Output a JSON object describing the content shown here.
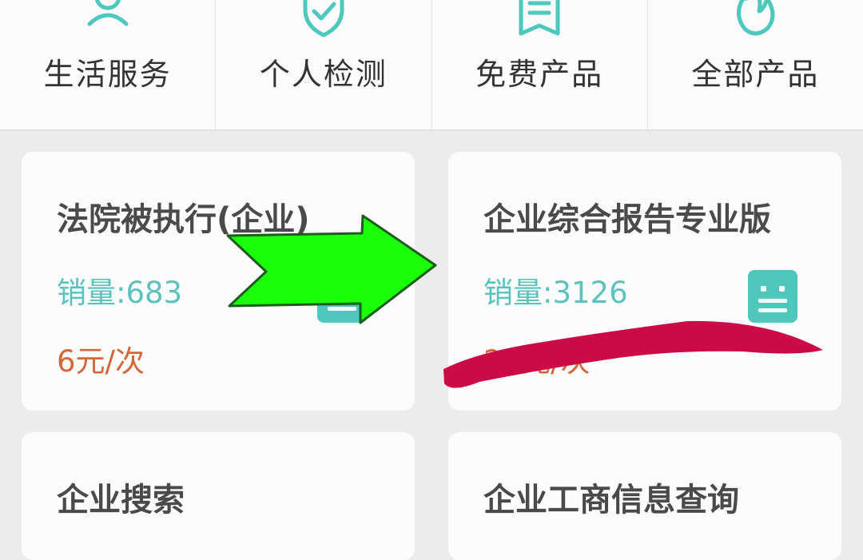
{
  "nav": {
    "items": [
      {
        "label": "生活服务",
        "icon": "people-icon"
      },
      {
        "label": "个人检测",
        "icon": "shield-check-icon"
      },
      {
        "label": "免费产品",
        "icon": "document-icon"
      },
      {
        "label": "全部产品",
        "icon": "fire-icon"
      }
    ]
  },
  "cards": [
    {
      "title": "法院被执行(企业)",
      "sales": "销量:683",
      "price": "6元/次"
    },
    {
      "title": "企业综合报告专业版",
      "sales": "销量:3126",
      "price": "29元/次"
    },
    {
      "title": "企业搜索"
    },
    {
      "title": "企业工商信息查询"
    }
  ],
  "colors": {
    "accent": "#4ec7bd",
    "sales_text": "#5bc2bd",
    "price_text": "#d2673b",
    "arrow_green": "#1aff0a",
    "scribble": "#cc0a45"
  }
}
